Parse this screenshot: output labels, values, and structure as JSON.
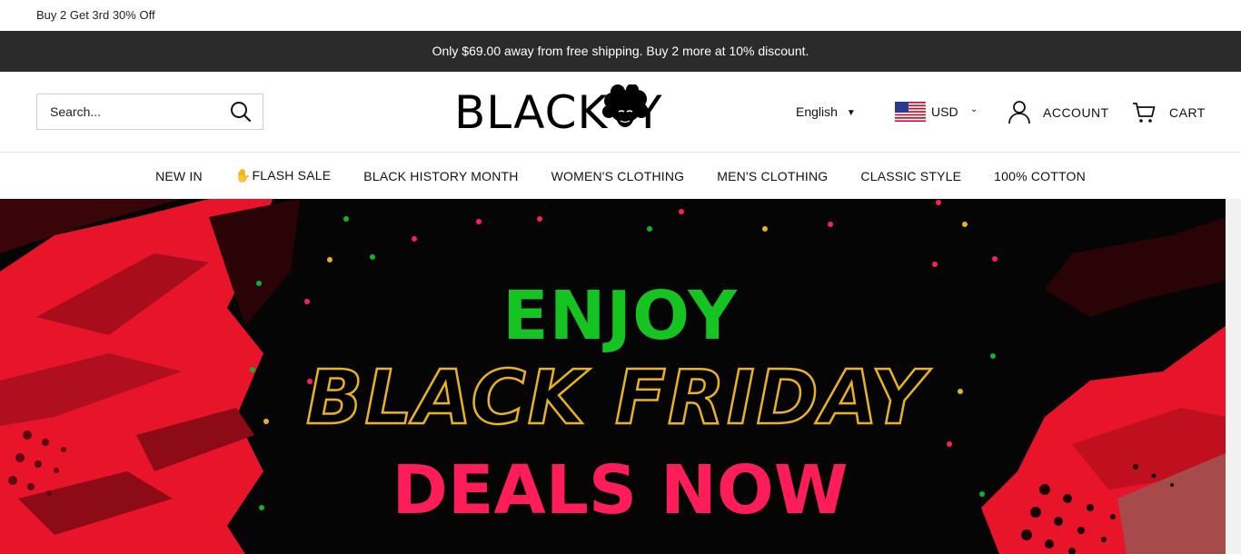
{
  "promo": {
    "text": "Buy 2 Get 3rd 30% Off"
  },
  "shipping": {
    "text": "Only $69.00 away from free shipping. Buy 2 more at 10% discount."
  },
  "search": {
    "placeholder": "Search..."
  },
  "logo": {
    "text": "BLACKOY"
  },
  "header": {
    "language": "English",
    "currency": "USD",
    "account_label": "ACCOUNT",
    "cart_label": "CART"
  },
  "nav": {
    "items": [
      {
        "label": "NEW IN"
      },
      {
        "label": "FLASH SALE",
        "icon": "flame-icon"
      },
      {
        "label": "BLACK HISTORY MONTH"
      },
      {
        "label": "WOMEN'S CLOTHING"
      },
      {
        "label": "MEN'S CLOTHING"
      },
      {
        "label": "CLASSIC STYLE"
      },
      {
        "label": "100% COTTON"
      }
    ]
  },
  "hero": {
    "line1": "ENJOY",
    "line2": "BLACK FRIDAY",
    "line3": "DEALS NOW"
  },
  "colors": {
    "shipping_bar": "#2b2b2b",
    "enjoy": "#15c421",
    "black_friday_outline": "#e9b21e",
    "deals": "#ff1d59",
    "hero_red": "#e8142a"
  }
}
